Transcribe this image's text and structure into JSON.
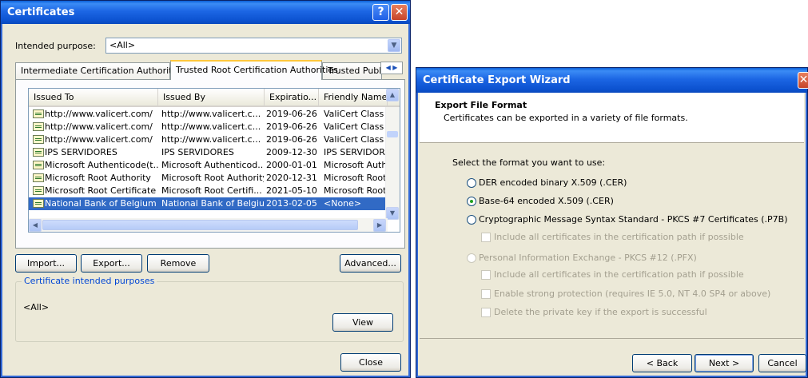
{
  "certificates": {
    "title": "Certificates",
    "intended_purpose_label": "Intended purpose:",
    "intended_purpose_value": "<All>",
    "tabs": [
      {
        "label": "Intermediate Certification Authorities"
      },
      {
        "label": "Trusted Root Certification Authorities"
      },
      {
        "label": "Trusted Publ"
      }
    ],
    "columns": [
      "Issued To",
      "Issued By",
      "Expiratio...",
      "Friendly Name"
    ],
    "rows": [
      {
        "issued_to": "http://www.valicert.com/",
        "issued_by": "http://www.valicert.c...",
        "expiration": "2019-06-26",
        "friendly": "ValiCert Class"
      },
      {
        "issued_to": "http://www.valicert.com/",
        "issued_by": "http://www.valicert.c...",
        "expiration": "2019-06-26",
        "friendly": "ValiCert Class :"
      },
      {
        "issued_to": "http://www.valicert.com/",
        "issued_by": "http://www.valicert.c...",
        "expiration": "2019-06-26",
        "friendly": "ValiCert Class :"
      },
      {
        "issued_to": "IPS SERVIDORES",
        "issued_by": "IPS SERVIDORES",
        "expiration": "2009-12-30",
        "friendly": "IPS SERVIDOR"
      },
      {
        "issued_to": "Microsoft Authenticode(t...",
        "issued_by": "Microsoft Authenticod...",
        "expiration": "2000-01-01",
        "friendly": "Microsoft Auth"
      },
      {
        "issued_to": "Microsoft Root Authority",
        "issued_by": "Microsoft Root Authority",
        "expiration": "2020-12-31",
        "friendly": "Microsoft Root"
      },
      {
        "issued_to": "Microsoft Root Certificate ...",
        "issued_by": "Microsoft Root Certifi...",
        "expiration": "2021-05-10",
        "friendly": "Microsoft Root"
      },
      {
        "issued_to": "National Bank of Belgium",
        "issued_by": "National Bank of Belgium",
        "expiration": "2013-02-05",
        "friendly": "<None>",
        "selected": true
      }
    ],
    "buttons": {
      "import": "Import...",
      "export": "Export...",
      "remove": "Remove",
      "advanced": "Advanced...",
      "view": "View",
      "close": "Close"
    },
    "purposes_group_label": "Certificate intended purposes",
    "purposes_value": "<All>"
  },
  "wizard": {
    "title": "Certificate Export Wizard",
    "header_title": "Export File Format",
    "header_subtitle": "Certificates can be exported in a variety of file formats.",
    "prompt": "Select the format you want to use:",
    "options": [
      {
        "label": "DER encoded binary X.509 (.CER)",
        "checked": false,
        "enabled": true
      },
      {
        "label": "Base-64 encoded X.509 (.CER)",
        "checked": true,
        "enabled": true
      },
      {
        "label": "Cryptographic Message Syntax Standard - PKCS #7 Certificates (.P7B)",
        "checked": false,
        "enabled": true
      },
      {
        "label": "Personal Information Exchange - PKCS #12 (.PFX)",
        "checked": false,
        "enabled": false
      }
    ],
    "pkcs7_sub": "Include all certificates in the certification path if possible",
    "pfx_subs": [
      "Include all certificates in the certification path if possible",
      "Enable strong protection (requires IE 5.0, NT 4.0 SP4 or above)",
      "Delete the private key if the export is successful"
    ],
    "buttons": {
      "back": "< Back",
      "next": "Next >",
      "cancel": "Cancel"
    }
  }
}
